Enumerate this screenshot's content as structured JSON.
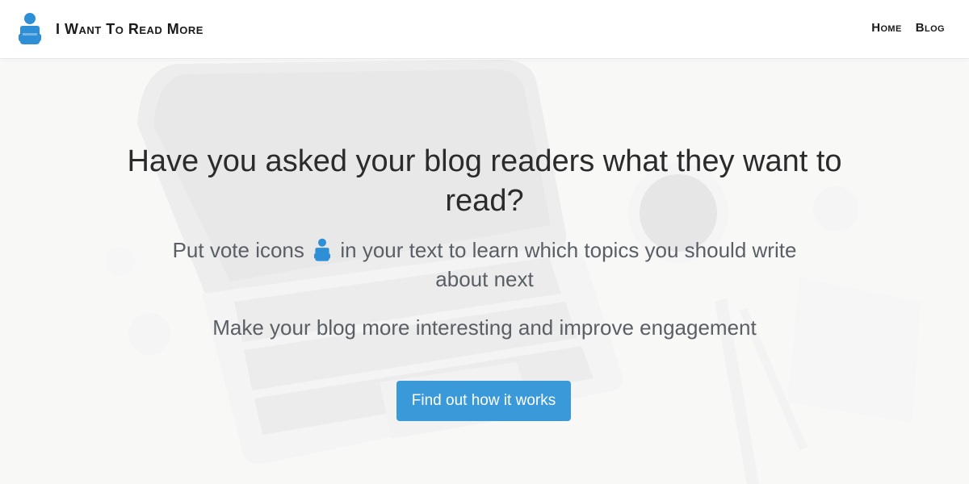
{
  "header": {
    "brand": "I Want To Read More",
    "brand_icon": "reader-person-icon",
    "nav": [
      {
        "label": "Home"
      },
      {
        "label": "Blog"
      }
    ]
  },
  "hero": {
    "headline": "Have you asked your blog readers what they want to read?",
    "sub_before_icon": "Put vote icons",
    "sub_after_icon": "in your text to learn which topics you should write about next",
    "inline_icon": "reader-person-icon",
    "sub2": "Make your blog more interesting and improve engagement",
    "cta_label": "Find out how it works"
  },
  "colors": {
    "accent": "#3a9ad9",
    "icon": "#2f8fd6",
    "text_dark": "#2b2b2b",
    "text_muted": "#5a5f66"
  }
}
